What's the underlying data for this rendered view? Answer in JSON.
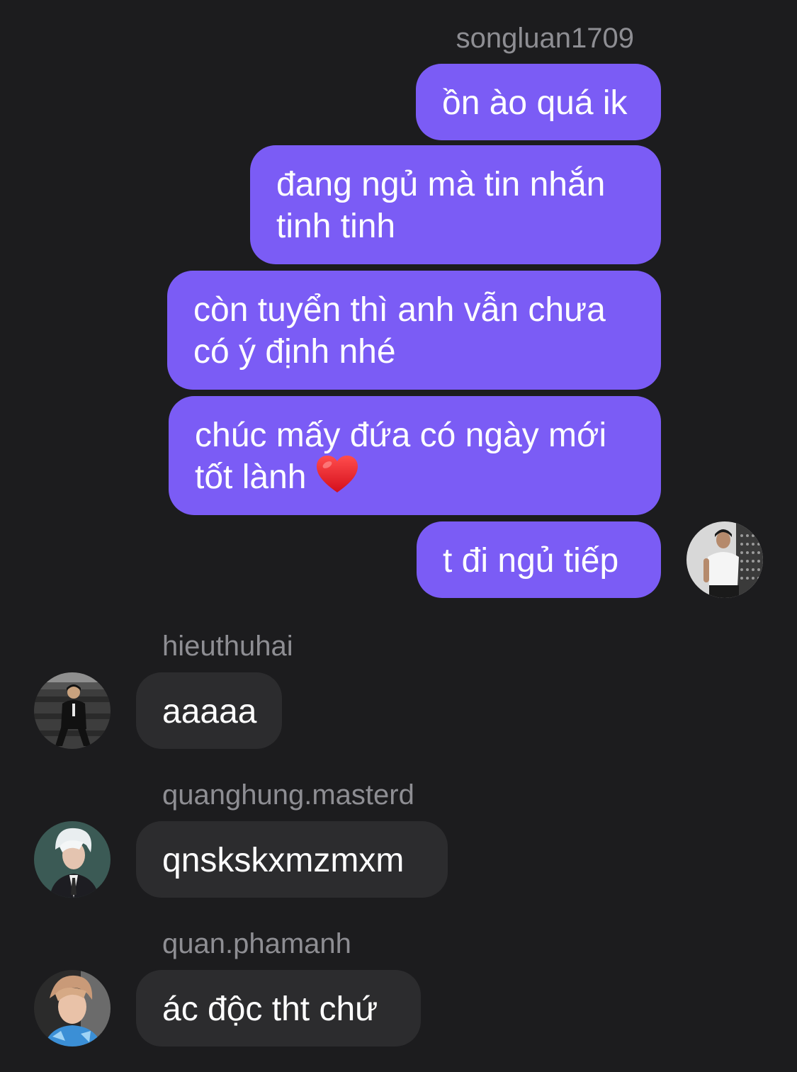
{
  "outgoing": {
    "sender": "songluan1709",
    "messages": [
      {
        "lines": [
          "ồn ào quá ik"
        ]
      },
      {
        "lines": [
          "đang ngủ mà tin nhắn",
          "tinh tinh"
        ]
      },
      {
        "lines": [
          "còn tuyển thì anh vẫn chưa",
          "có ý định nhé"
        ]
      },
      {
        "lines": [
          "chúc mấy đứa có ngày mới",
          "tốt lành"
        ],
        "emoji": "heart-emoji"
      },
      {
        "lines": [
          "t đi ngủ tiếp"
        ]
      }
    ]
  },
  "incoming": [
    {
      "sender": "hieuthuhai",
      "message": "aaaaa"
    },
    {
      "sender": "quanghung.masterd",
      "message": "qnskskxmzmxm"
    },
    {
      "sender": "quan.phamanh",
      "message": "ác độc tht chứ"
    }
  ],
  "colors": {
    "background": "#1c1c1e",
    "outgoing_bubble": "#7b5cf5",
    "incoming_bubble": "#2c2c2e",
    "sender_name": "#8e8e93",
    "text": "#ffffff"
  }
}
